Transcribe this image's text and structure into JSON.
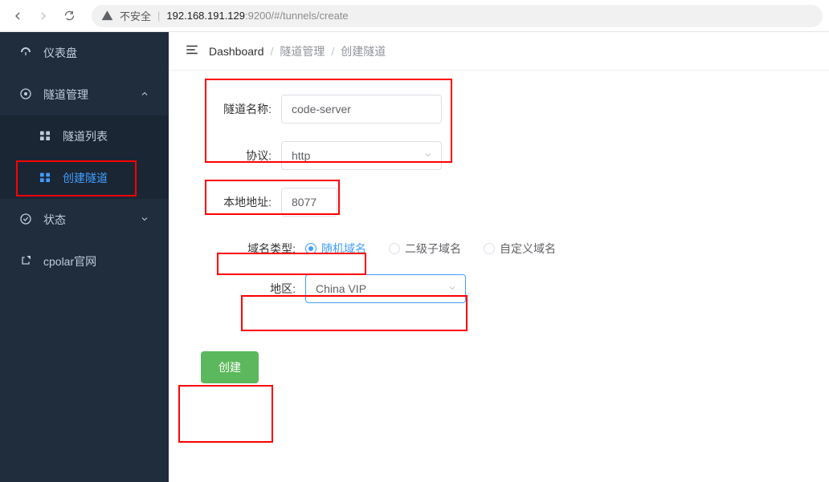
{
  "browser": {
    "insecure_label": "不安全",
    "url_host": "192.168.191.129",
    "url_port_path": ":9200/#/tunnels/create"
  },
  "sidebar": {
    "dashboard": "仪表盘",
    "tunnel_mgmt": "隧道管理",
    "tunnel_list": "隧道列表",
    "tunnel_create": "创建隧道",
    "status": "状态",
    "cpolar_site": "cpolar官网"
  },
  "breadcrumb": {
    "dashboard": "Dashboard",
    "tunnel_mgmt": "隧道管理",
    "tunnel_create": "创建隧道"
  },
  "form": {
    "name_label": "隧道名称:",
    "name_value": "code-server",
    "proto_label": "协议:",
    "proto_value": "http",
    "local_label": "本地地址:",
    "local_value": "8077",
    "domain_type_label": "域名类型:",
    "domain_random": "随机域名",
    "domain_second": "二级子域名",
    "domain_custom": "自定义域名",
    "region_label": "地区:",
    "region_value": "China VIP",
    "submit_label": "创建"
  }
}
